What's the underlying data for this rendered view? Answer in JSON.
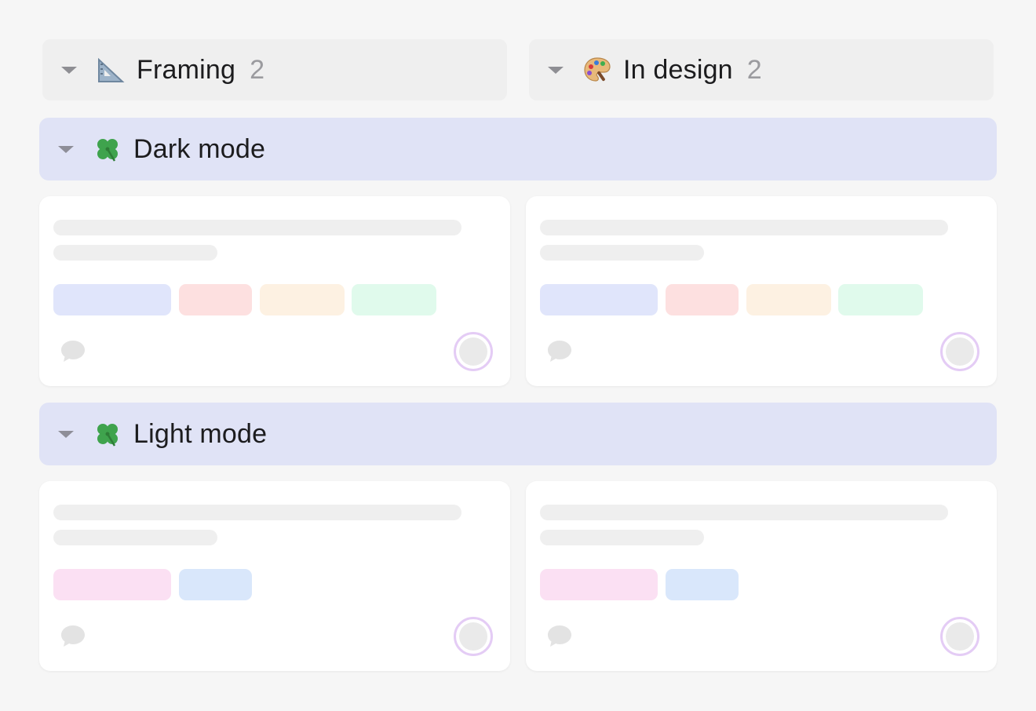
{
  "columns": [
    {
      "label": "Framing",
      "count": "2",
      "icon": "triangular-ruler-icon"
    },
    {
      "label": "In design",
      "count": "2",
      "icon": "artist-palette-icon"
    }
  ],
  "groups": [
    {
      "label": "Dark mode",
      "icon": "four-leaf-clover-icon",
      "tag_colors": [
        "#e0e5fb",
        "#fde0e0",
        "#fdf1e2",
        "#e0faec"
      ]
    },
    {
      "label": "Light mode",
      "icon": "four-leaf-clover-icon",
      "tag_colors": [
        "#fbe0f3",
        "#d9e7fb"
      ]
    }
  ],
  "colors": {
    "background": "#f6f6f6",
    "column_header": "#efefef",
    "group_header": "#e0e3f6",
    "avatar_ring": "#e4ccf5"
  }
}
